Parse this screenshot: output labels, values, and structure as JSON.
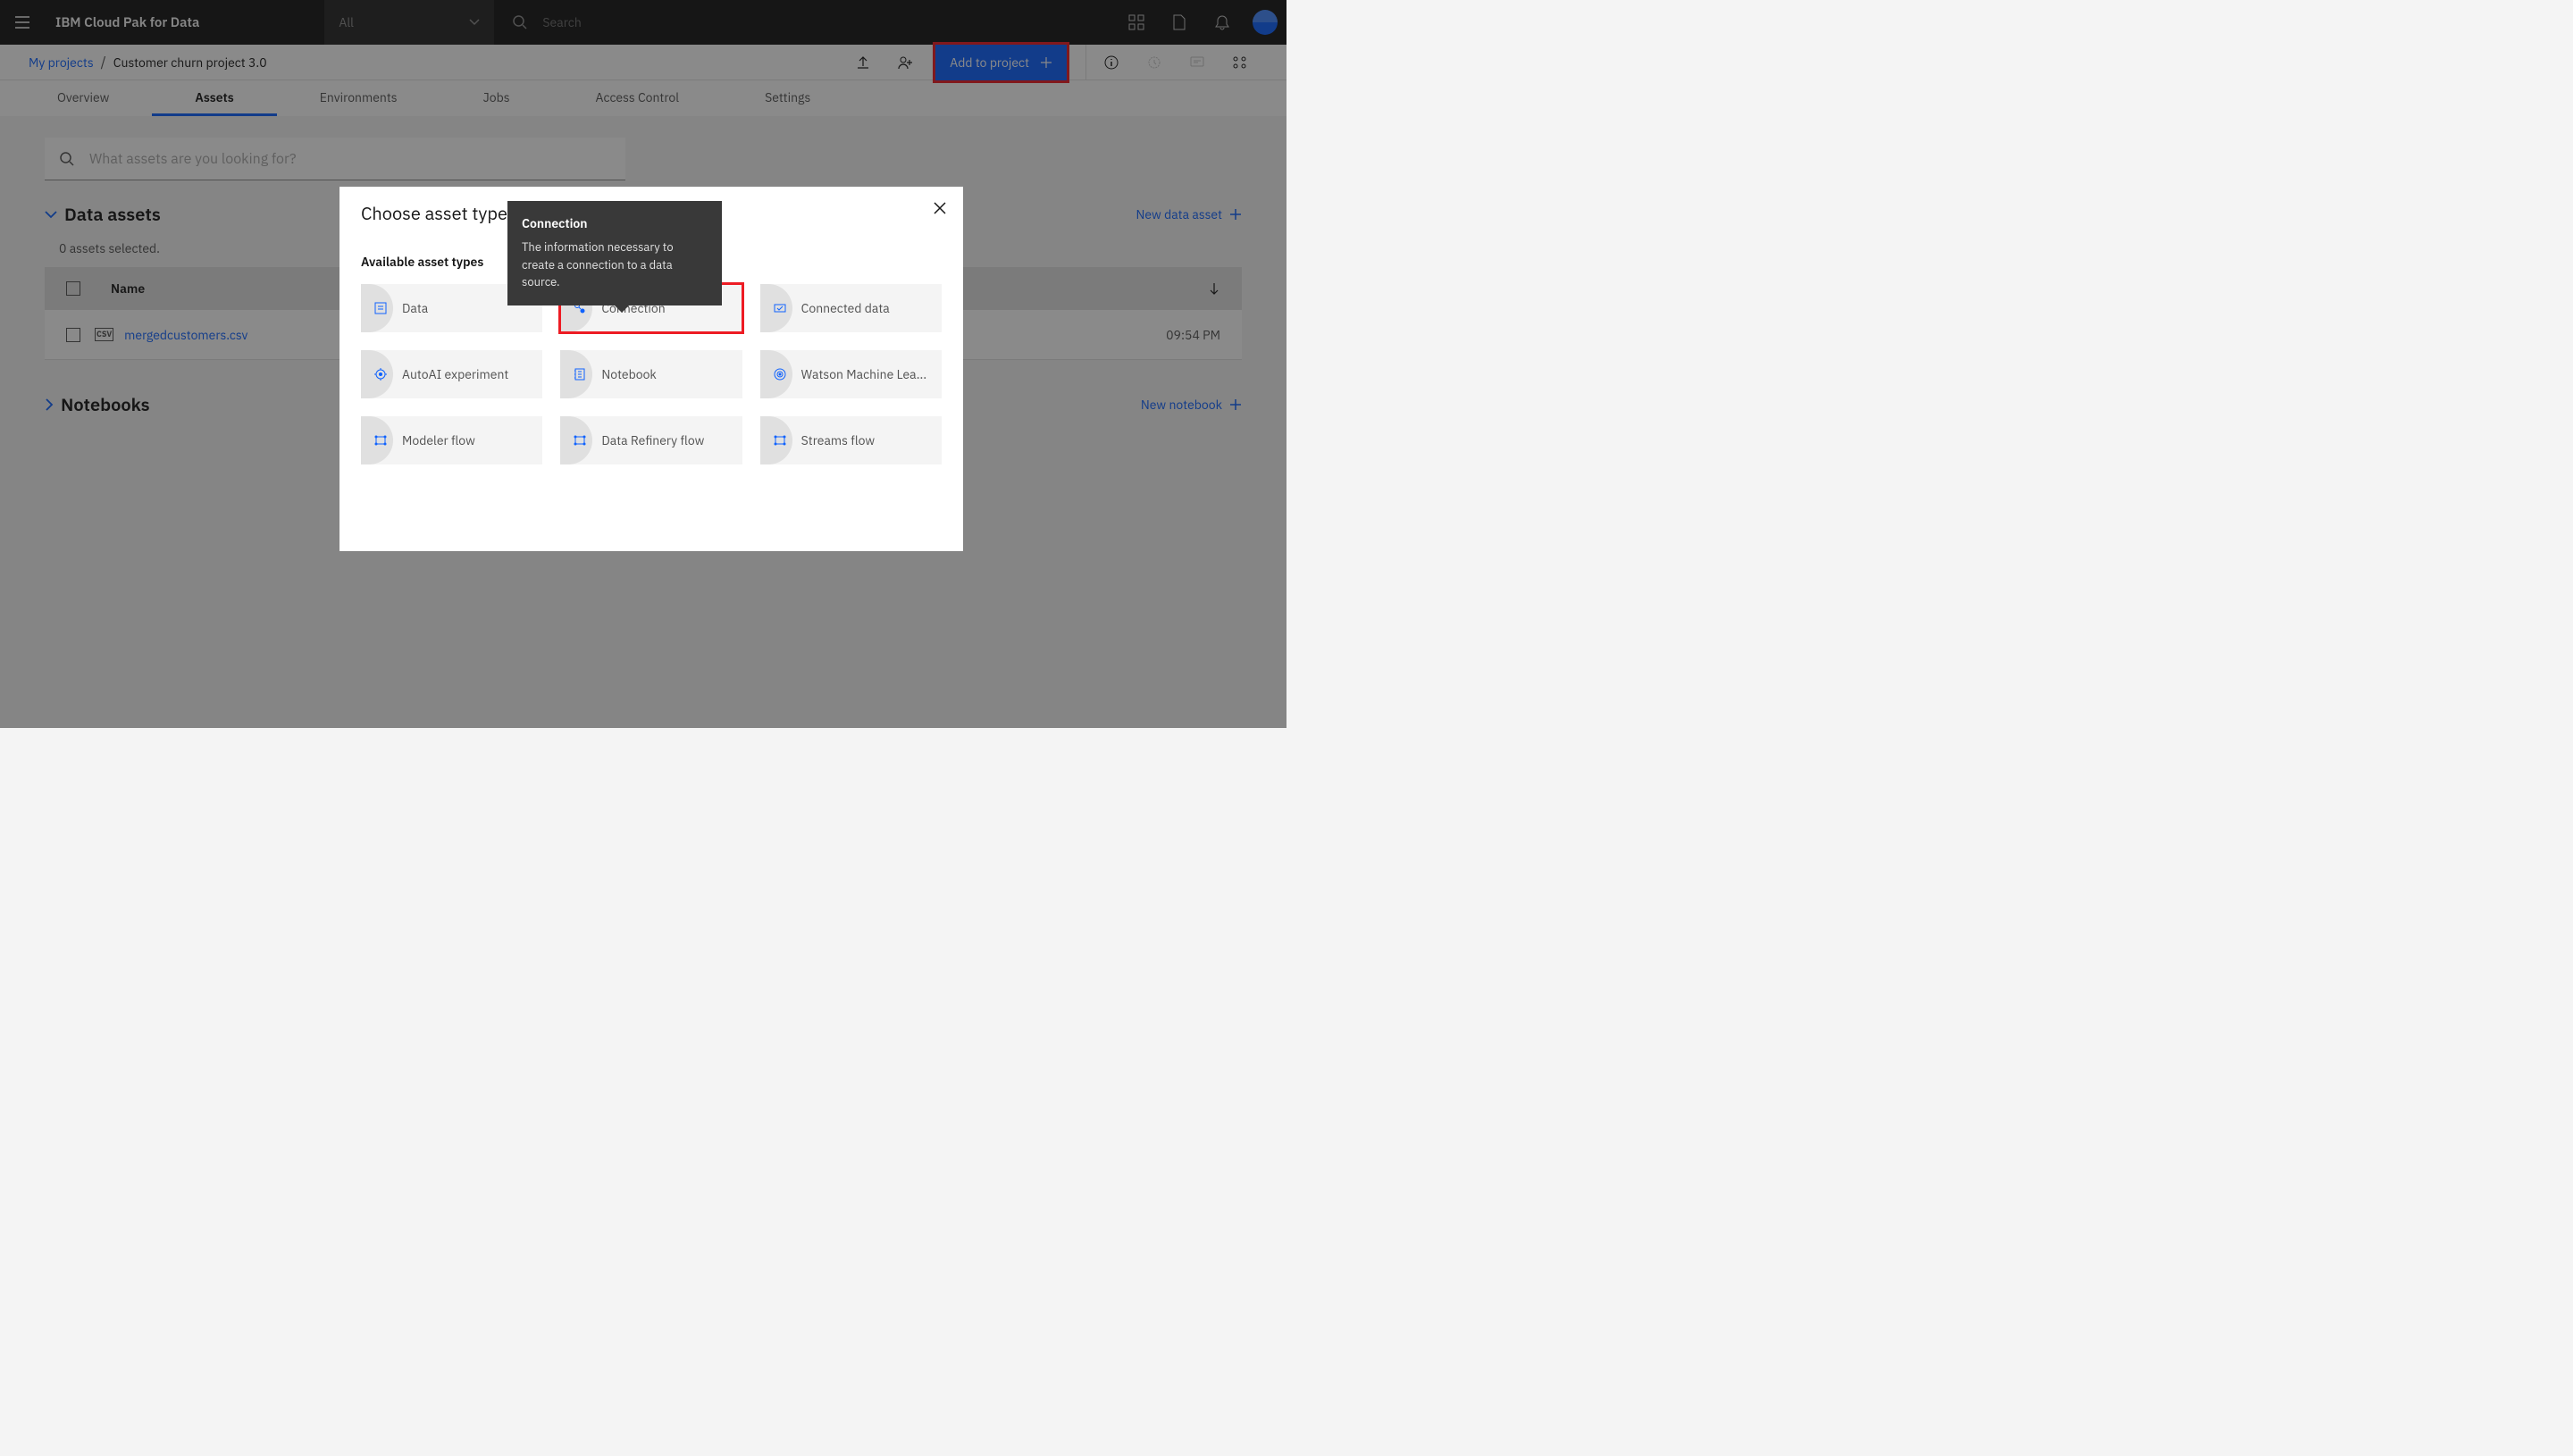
{
  "header": {
    "appTitle": "IBM Cloud Pak for Data",
    "dropdownAll": "All",
    "searchPlaceholder": "Search"
  },
  "breadcrumb": {
    "myProjects": "My projects",
    "current": "Customer churn project 3.0"
  },
  "addToProjectBtn": "Add to project",
  "tabs": [
    {
      "label": "Overview",
      "active": false
    },
    {
      "label": "Assets",
      "active": true
    },
    {
      "label": "Environments",
      "active": false
    },
    {
      "label": "Jobs",
      "active": false
    },
    {
      "label": "Access Control",
      "active": false
    },
    {
      "label": "Settings",
      "active": false
    }
  ],
  "assetSearchPlaceholder": "What assets are you looking for?",
  "sections": {
    "dataAssets": {
      "title": "Data assets",
      "action": "New data asset",
      "selectedText": "0 assets selected.",
      "columns": {
        "name": "Name"
      },
      "rows": [
        {
          "type": "CSV",
          "name": "mergedcustomers.csv",
          "time": "09:54 PM"
        }
      ]
    },
    "notebooks": {
      "title": "Notebooks",
      "action": "New notebook"
    }
  },
  "modal": {
    "title": "Choose asset type",
    "subtitle": "Available asset types",
    "tiles": [
      {
        "label": "Data",
        "highlight": false
      },
      {
        "label": "Connection",
        "highlight": true
      },
      {
        "label": "Connected data",
        "highlight": false
      },
      {
        "label": "AutoAI experiment",
        "highlight": false
      },
      {
        "label": "Notebook",
        "highlight": false
      },
      {
        "label": "Watson Machine Lea...",
        "highlight": false
      },
      {
        "label": "Modeler flow",
        "highlight": false
      },
      {
        "label": "Data Refinery flow",
        "highlight": false
      },
      {
        "label": "Streams flow",
        "highlight": false
      }
    ]
  },
  "tooltip": {
    "title": "Connection",
    "body": "The information necessary to create a connection to a data source."
  }
}
